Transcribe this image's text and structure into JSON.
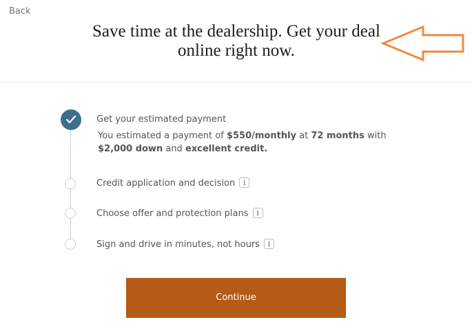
{
  "nav": {
    "back_label": "Back"
  },
  "headline": {
    "text": "Save time at the dealership. Get your deal online right now."
  },
  "annotation": {
    "arrow_color": "#f08a3c"
  },
  "steps": [
    {
      "title": "Get your estimated payment",
      "status": "completed",
      "description": {
        "t1": "You estimated a payment of ",
        "payment": "$550/monthly",
        "t2": " at ",
        "term": "72 months",
        "t3": " with ",
        "down": "$2,000 down",
        "t4": " and ",
        "credit": "excellent credit.",
        "t5": ""
      }
    },
    {
      "title": "Credit application and decision",
      "status": "pending",
      "info_icon": "info-icon"
    },
    {
      "title": "Choose offer and protection plans",
      "status": "pending",
      "info_icon": "info-icon"
    },
    {
      "title": "Sign and drive in minutes, not hours",
      "status": "pending",
      "info_icon": "info-icon"
    }
  ],
  "info_glyph": "i",
  "actions": {
    "continue_label": "Continue"
  },
  "colors": {
    "accent_button": "#b35b17",
    "completed_step": "#3e6e8e",
    "arrow": "#f08a3c"
  }
}
